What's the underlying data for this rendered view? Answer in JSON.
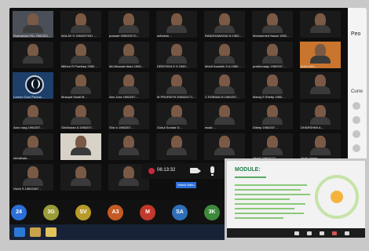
{
  "meeting": {
    "timer": "06:13:32",
    "active_speaker_label": "Manik Bahu"
  },
  "tiles": [
    {
      "name": "Rudraksha PAL 2960201…",
      "tone": "gray"
    },
    {
      "name": "MALAV S 1960257091 …",
      "tone": "dark"
    },
    {
      "name": "prasant 296020170…",
      "tone": "dark"
    },
    {
      "name": "adhoksh…",
      "tone": "dark"
    },
    {
      "name": "RANDHAWASAI N 1960…",
      "tone": "dark"
    },
    {
      "name": "Mohammed Nasar 1960…",
      "tone": "dark"
    },
    {
      "name": "",
      "tone": "dark"
    },
    {
      "name": "",
      "tone": "dark"
    },
    {
      "name": "Mithun R Pradeep 2960…",
      "tone": "dark"
    },
    {
      "name": "Md Mussab Alam 1960…",
      "tone": "dark"
    },
    {
      "name": "DEEKSHA S H 1960…",
      "tone": "dark"
    },
    {
      "name": "Mohit Kaushik S A 1960…",
      "tone": "dark"
    },
    {
      "name": "prabhuraaju 1960207…",
      "tone": "dark"
    },
    {
      "name": "MADHAN…",
      "tone": "orange"
    },
    {
      "name": "Lorenz Gurn Parkas…",
      "tone": "blue"
    },
    {
      "name": "Mosquit Swati M…",
      "tone": "dark"
    },
    {
      "name": "Abu Jose 1960207…",
      "tone": "dark"
    },
    {
      "name": "M PRUPATHI 296020171…",
      "tone": "dark"
    },
    {
      "name": "C ROBINA M 1960207…",
      "tone": "dark"
    },
    {
      "name": "Manoj S Shetty 1960…",
      "tone": "dark"
    },
    {
      "name": "",
      "tone": "dark"
    },
    {
      "name": "Arun raag 1960207…",
      "tone": "dark"
    },
    {
      "name": "Giridharan A 1960207…",
      "tone": "dark"
    },
    {
      "name": "Shiv s 1960207…",
      "tone": "dark"
    },
    {
      "name": "Gokul Sundar D…",
      "tone": "dark"
    },
    {
      "name": "esaki …",
      "tone": "dark"
    },
    {
      "name": "Dileep 1960207…",
      "tone": "dark"
    },
    {
      "name": "DHARSHINI A…",
      "tone": "dark"
    },
    {
      "name": "christbala…",
      "tone": "dark"
    },
    {
      "name": "",
      "tone": "bright"
    },
    {
      "name": "",
      "tone": "dark"
    },
    {
      "name": "",
      "tone": "dark"
    },
    {
      "name": "",
      "tone": "dark"
    },
    {
      "name": "Vinod 19602077…",
      "tone": "dark"
    },
    {
      "name": "shaik jabeer…",
      "tone": "dark"
    },
    {
      "name": "Vivek S 19602067…",
      "tone": "dark"
    },
    {
      "name": "",
      "tone": "dark"
    },
    {
      "name": "",
      "tone": "dark"
    }
  ],
  "side_panel": {
    "title": "Peo",
    "section": "Curre"
  },
  "avatars": [
    {
      "initials": "24",
      "color": "#2d6fd8"
    },
    {
      "initials": "3G",
      "color": "#9b9b3a"
    },
    {
      "initials": "SV",
      "color": "#b89a2b"
    },
    {
      "initials": "A3",
      "color": "#c55a24"
    },
    {
      "initials": "M",
      "color": "#c0392b"
    },
    {
      "initials": "SA",
      "color": "#2e6fb8"
    },
    {
      "initials": "3K",
      "color": "#3d8a3a"
    }
  ],
  "slide": {
    "title": "MODULE:"
  },
  "colors": {
    "accent": "#2e6fd8",
    "record": "#c5283d",
    "slide_green": "#1f7f46"
  },
  "icons": [
    "record-icon",
    "camera-icon",
    "microphone-icon",
    "more-icon"
  ]
}
